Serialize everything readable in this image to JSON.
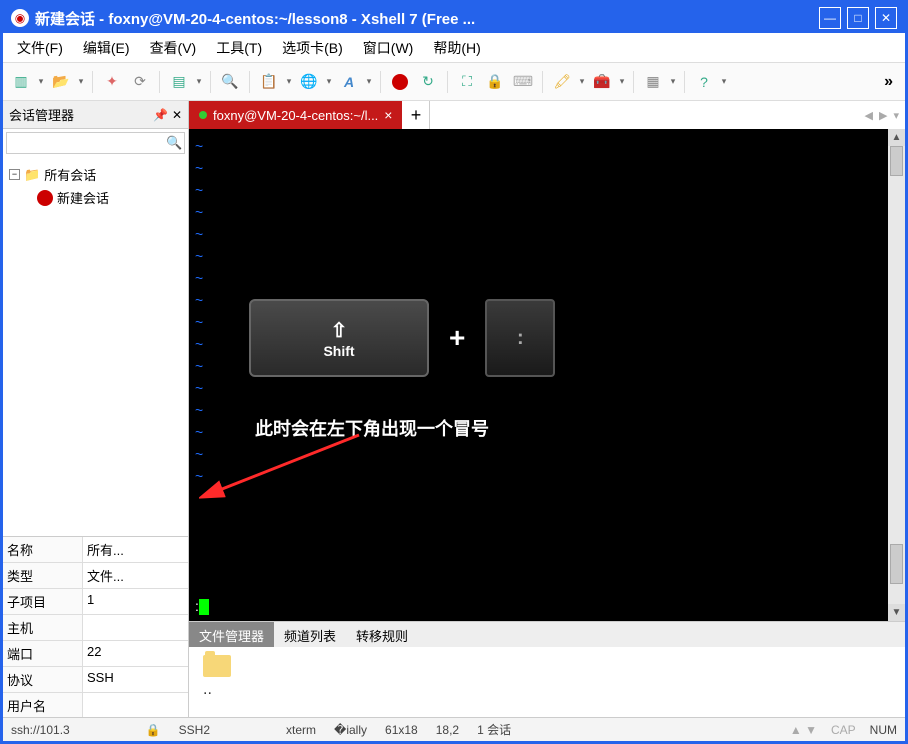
{
  "window": {
    "title": "新建会话 - foxny@VM-20-4-centos:~/lesson8 - Xshell 7 (Free ..."
  },
  "menu": {
    "file": "文件(F)",
    "edit": "编辑(E)",
    "view": "查看(V)",
    "tools": "工具(T)",
    "tabs": "选项卡(B)",
    "window": "窗口(W)",
    "help": "帮助(H)"
  },
  "sessionPanel": {
    "title": "会话管理器",
    "searchPlaceholder": "",
    "tree": {
      "root": "所有会话",
      "child": "新建会话"
    }
  },
  "props": [
    {
      "key": "名称",
      "val": "所有..."
    },
    {
      "key": "类型",
      "val": "文件..."
    },
    {
      "key": "子项目",
      "val": "1"
    },
    {
      "key": "主机",
      "val": ""
    },
    {
      "key": "端口",
      "val": "22"
    },
    {
      "key": "协议",
      "val": "SSH"
    },
    {
      "key": "用户名",
      "val": ""
    }
  ],
  "tab": {
    "label": "foxny@VM-20-4-centos:~/l..."
  },
  "illustration": {
    "shift": "Shift",
    "plus": "+",
    "colon": ":",
    "caption": "此时会在左下角出现一个冒号"
  },
  "prompt": ":",
  "bottomTabs": {
    "fileManager": "文件管理器",
    "channelList": "频道列表",
    "transferRules": "转移规则"
  },
  "fileMgr": {
    "dotdot": ".."
  },
  "status": {
    "conn": "ssh://101.3",
    "proto": "SSH2",
    "term": "xterm",
    "size": "61x18",
    "pos": "18,2",
    "sessions": "1 会话",
    "cap": "CAP",
    "num": "NUM"
  }
}
